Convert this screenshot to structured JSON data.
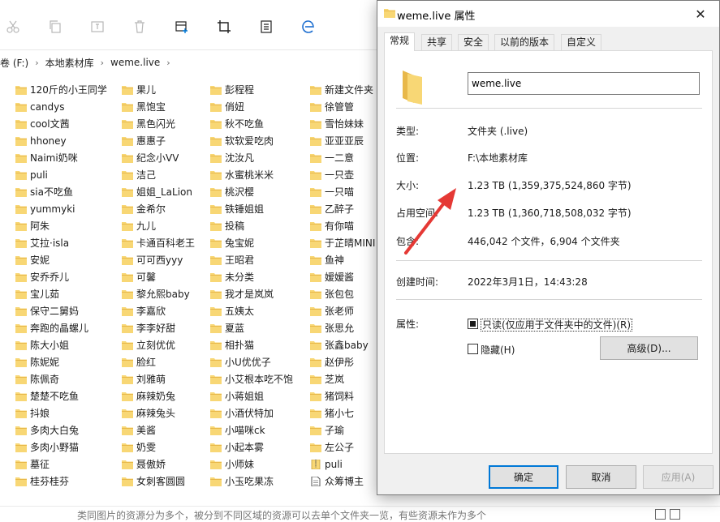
{
  "explorer": {
    "breadcrumb": [
      "卷 (F:)",
      "本地素材库",
      "weme.live"
    ],
    "columns": [
      [
        "120斤的小王同学",
        "candys",
        "cool文茜",
        "hhoney",
        "Naimi奶咪",
        "puli",
        "sia不吃鱼",
        "yummyki",
        "阿朱",
        "艾拉·isla",
        "安妮",
        "安乔乔儿",
        "宝儿茹",
        "保守二舅妈",
        "奔跑的晶螺儿",
        "陈大小姐",
        "陈妮妮",
        "陈佩奇",
        "楚楚不吃鱼",
        "抖娘",
        "多肉大白兔",
        "多肉小野猫",
        "墓征",
        "桂芬桂芬"
      ],
      [
        "果儿",
        "黑饱宝",
        "黑色闪光",
        "惠惠子",
        "纪念小VV",
        "洁己",
        "姐姐_LaLion",
        "金希尔",
        "九儿",
        "卡通百科老王",
        "可可西yyy",
        "可馨",
        "黎允熙baby",
        "李嘉欣",
        "李李好甜",
        "立刻优优",
        "脸红",
        "刘雅萌",
        "麻辣奶兔",
        "麻辣兔头",
        "美酱",
        "奶雯",
        "聂傲娇",
        "女刺客圆圆"
      ],
      [
        "彭程程",
        "俏妞",
        "秋不吃鱼",
        "软软爱吃肉",
        "沈汝凡",
        "水蜜桃米米",
        "桃沢樱",
        "铁锤姐姐",
        "投稿",
        "兔宝妮",
        "王昭君",
        "未分类",
        "我才是岚岚",
        "五姨太",
        "夏蓝",
        "相扑猫",
        "小U优优子",
        "小艾根本吃不饱",
        "小蒋姐姐",
        "小酒伏特加",
        "小喵咪ck",
        "小起本雾",
        "小师妹",
        "小玉吃果冻"
      ],
      [
        "新建文件夹",
        "徐管管",
        "雪怡妹妹",
        "亚亚亚辰",
        "一二意",
        "一只壶",
        "一只喵",
        "乙醉子",
        "有你喵",
        "于芷晴MINI",
        "鱼神",
        "嫒嫒酱",
        "张包包",
        "张老师",
        "张思允",
        "张鑫baby",
        "赵伊彤",
        "芝岚",
        "猪饲料",
        "猪小七",
        "子瑜",
        "左公子",
        "puli",
        "众筹博主"
      ]
    ],
    "special_icons": {
      "3.22": "zip-file-icon",
      "3.23": "document-icon"
    },
    "status_text": "类同图片的资源分为多个，被分到不同区域的资源可以去单个文件夹一览，有些资源未作为多个"
  },
  "dialog": {
    "title": "weme.live 属性",
    "tabs": [
      "常规",
      "共享",
      "安全",
      "以前的版本",
      "自定义"
    ],
    "active_tab": 0,
    "name_value": "weme.live",
    "props": {
      "type_label": "类型:",
      "type_value": "文件夹 (.live)",
      "location_label": "位置:",
      "location_value": "F:\\本地素材库",
      "size_label": "大小:",
      "size_value": "1.23 TB (1,359,375,524,860 字节)",
      "disk_label": "占用空间:",
      "disk_value": "1.23 TB (1,360,718,508,032 字节)",
      "contains_label": "包含:",
      "contains_value": "446,042 个文件，6,904 个文件夹",
      "created_label": "创建时间:",
      "created_value": "2022年3月1日，14:43:28",
      "attr_label": "属性:"
    },
    "readonly_label": "只读(仅应用于文件夹中的文件)(R)",
    "hidden_label": "隐藏(H)",
    "advanced_label": "高级(D)...",
    "ok_label": "确定",
    "cancel_label": "取消",
    "apply_label": "应用(A)"
  },
  "colors": {
    "folder": "#f8d775",
    "folder_dark": "#e8b84a",
    "accent": "#0078d7",
    "arrow": "#e53935"
  }
}
